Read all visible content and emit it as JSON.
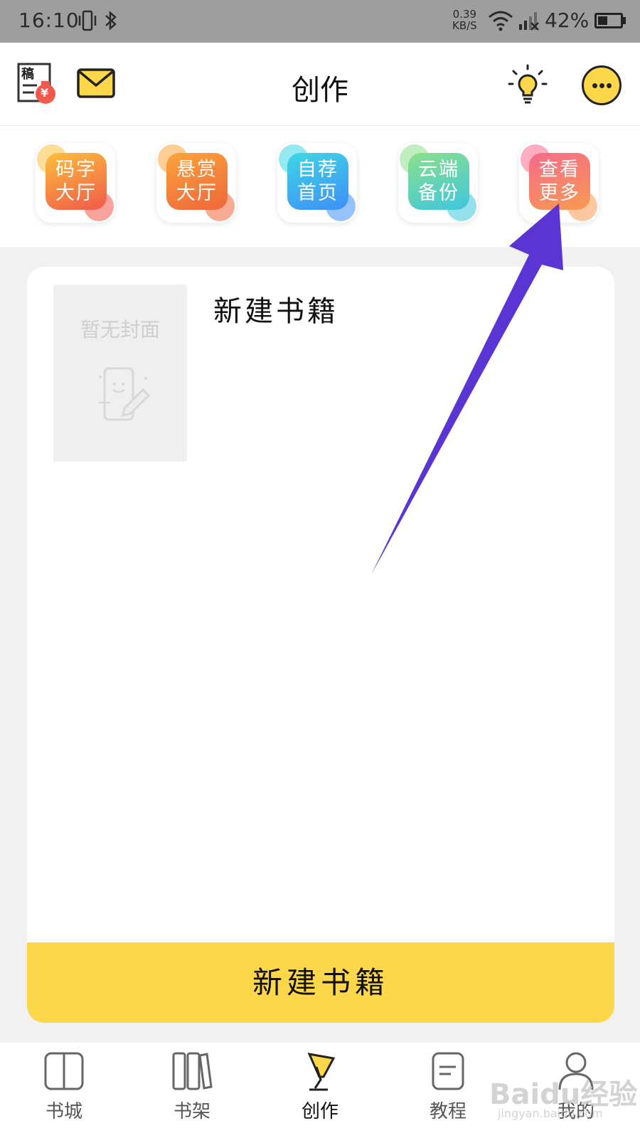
{
  "status_bar": {
    "time": "16:10",
    "net_speed_value": "0.39",
    "net_speed_unit": "KB/S",
    "battery": "42%",
    "battery_level": 0.42
  },
  "header": {
    "title": "创作",
    "draft_icon_text": "稿",
    "draft_badge": "¥"
  },
  "quick_tiles": [
    {
      "line1": "码字",
      "line2": "大厅",
      "color_top": "#fbbf3c",
      "color_bottom": "#f2594b"
    },
    {
      "line1": "悬赏",
      "line2": "大厅",
      "color_top": "#f9a43c",
      "color_bottom": "#f0663b"
    },
    {
      "line1": "自荐",
      "line2": "首页",
      "color_top": "#3fd6e6",
      "color_bottom": "#3e8ff5"
    },
    {
      "line1": "云端",
      "line2": "备份",
      "color_top": "#8ce08a",
      "color_bottom": "#3ec6de"
    },
    {
      "line1": "查看",
      "line2": "更多",
      "color_top": "#f56b8a",
      "color_bottom": "#f89a52"
    }
  ],
  "book_card": {
    "cover_placeholder": "暂无封面",
    "book_title": "新建书籍",
    "create_button": "新建书籍"
  },
  "bottom_nav": [
    {
      "label": "书城"
    },
    {
      "label": "书架"
    },
    {
      "label": "创作"
    },
    {
      "label": "教程"
    },
    {
      "label": "我的"
    }
  ],
  "watermark": {
    "main": "Baidu经验",
    "sub": "jingyan.baidu.com"
  },
  "colors": {
    "accent": "#fcd74a",
    "arrow": "#5b34d4"
  }
}
